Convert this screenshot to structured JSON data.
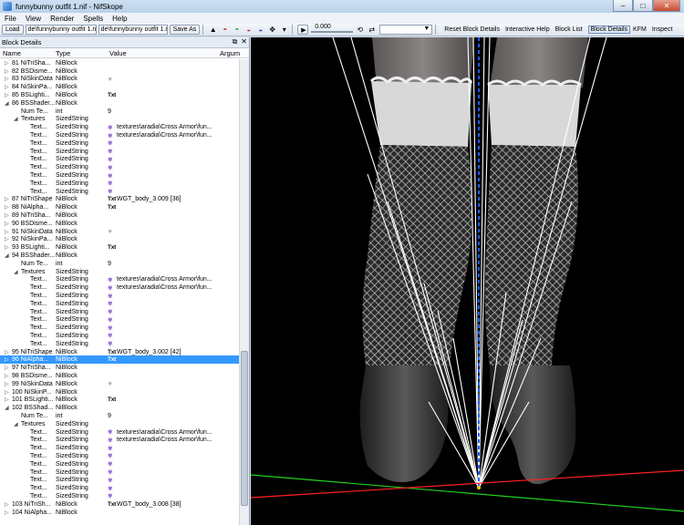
{
  "window": {
    "title": "funnybunny outfit 1.nif - NifSkope",
    "min": "–",
    "max": "□",
    "close": "✕"
  },
  "menu": [
    "File",
    "View",
    "Render",
    "Spells",
    "Help"
  ],
  "toolbar": {
    "load": "Load",
    "load_path": "de\\funnybunny outfit 1.nif",
    "save_path": "de\\funnybunny outfit 1.nif",
    "save_as": "Save As",
    "anim_time": "0.000",
    "links": [
      "Reset Block Details",
      "Interactive Help",
      "Block List",
      "Block Details",
      "KFM",
      "Inspect"
    ],
    "active_link": "Block Details"
  },
  "panel": {
    "title": "Block Details",
    "columns": [
      "Name",
      "Type",
      "Value",
      "Argum"
    ],
    "rows": [
      {
        "indent": 0,
        "exp": "▷",
        "name": "81 NiTriSha...",
        "type": "NiBlock",
        "icon": "",
        "value": ""
      },
      {
        "indent": 0,
        "exp": "▷",
        "name": "82 BSDisme...",
        "type": "NiBlock",
        "icon": "",
        "value": ""
      },
      {
        "indent": 0,
        "exp": "▷",
        "name": "83 NiSkinData",
        "type": "NiBlock",
        "icon": "star",
        "value": ""
      },
      {
        "indent": 0,
        "exp": "▷",
        "name": "84 NiSkinPa...",
        "type": "NiBlock",
        "icon": "",
        "value": ""
      },
      {
        "indent": 0,
        "exp": "▷",
        "name": "85 BSLighti...",
        "type": "NiBlock",
        "icon": "txt",
        "value": ""
      },
      {
        "indent": 0,
        "exp": "◢",
        "name": "86 BSShader...",
        "type": "NiBlock",
        "icon": "",
        "value": ""
      },
      {
        "indent": 1,
        "exp": "",
        "name": "Num Te...",
        "type": "int",
        "icon": "",
        "value": "9"
      },
      {
        "indent": 1,
        "exp": "◢",
        "name": "Textures",
        "type": "SizedString",
        "icon": "",
        "value": ""
      },
      {
        "indent": 2,
        "exp": "",
        "name": "Text...",
        "type": "SizedString",
        "icon": "tex",
        "value": "textures\\aradia\\Cross Armor\\fun..."
      },
      {
        "indent": 2,
        "exp": "",
        "name": "Text...",
        "type": "SizedString",
        "icon": "tex",
        "value": "textures\\aradia\\Cross Armor\\fun..."
      },
      {
        "indent": 2,
        "exp": "",
        "name": "Text...",
        "type": "SizedString",
        "icon": "tex",
        "value": ""
      },
      {
        "indent": 2,
        "exp": "",
        "name": "Text...",
        "type": "SizedString",
        "icon": "tex",
        "value": ""
      },
      {
        "indent": 2,
        "exp": "",
        "name": "Text...",
        "type": "SizedString",
        "icon": "tex",
        "value": ""
      },
      {
        "indent": 2,
        "exp": "",
        "name": "Text...",
        "type": "SizedString",
        "icon": "tex",
        "value": ""
      },
      {
        "indent": 2,
        "exp": "",
        "name": "Text...",
        "type": "SizedString",
        "icon": "tex",
        "value": ""
      },
      {
        "indent": 2,
        "exp": "",
        "name": "Text...",
        "type": "SizedString",
        "icon": "tex",
        "value": ""
      },
      {
        "indent": 2,
        "exp": "",
        "name": "Text...",
        "type": "SizedString",
        "icon": "tex",
        "value": ""
      },
      {
        "indent": 0,
        "exp": "▷",
        "name": "87 NiTriShape",
        "type": "NiBlock",
        "icon": "txt",
        "value": "WGT_body_3.009 [36]"
      },
      {
        "indent": 0,
        "exp": "▷",
        "name": "88 NiAlpha...",
        "type": "NiBlock",
        "icon": "txt",
        "value": ""
      },
      {
        "indent": 0,
        "exp": "▷",
        "name": "89 NiTriSha...",
        "type": "NiBlock",
        "icon": "",
        "value": ""
      },
      {
        "indent": 0,
        "exp": "▷",
        "name": "90 BSDisme...",
        "type": "NiBlock",
        "icon": "",
        "value": ""
      },
      {
        "indent": 0,
        "exp": "▷",
        "name": "91 NiSkinData",
        "type": "NiBlock",
        "icon": "star",
        "value": ""
      },
      {
        "indent": 0,
        "exp": "▷",
        "name": "92 NiSkinPa...",
        "type": "NiBlock",
        "icon": "",
        "value": ""
      },
      {
        "indent": 0,
        "exp": "▷",
        "name": "93 BSLighti...",
        "type": "NiBlock",
        "icon": "txt",
        "value": ""
      },
      {
        "indent": 0,
        "exp": "◢",
        "name": "94 BSShader...",
        "type": "NiBlock",
        "icon": "",
        "value": ""
      },
      {
        "indent": 1,
        "exp": "",
        "name": "Num Te...",
        "type": "int",
        "icon": "",
        "value": "9"
      },
      {
        "indent": 1,
        "exp": "◢",
        "name": "Textures",
        "type": "SizedString",
        "icon": "",
        "value": ""
      },
      {
        "indent": 2,
        "exp": "",
        "name": "Text...",
        "type": "SizedString",
        "icon": "tex",
        "value": "textures\\aradia\\Cross Armor\\fun..."
      },
      {
        "indent": 2,
        "exp": "",
        "name": "Text...",
        "type": "SizedString",
        "icon": "tex",
        "value": "textures\\aradia\\Cross Armor\\fun..."
      },
      {
        "indent": 2,
        "exp": "",
        "name": "Text...",
        "type": "SizedString",
        "icon": "tex",
        "value": ""
      },
      {
        "indent": 2,
        "exp": "",
        "name": "Text...",
        "type": "SizedString",
        "icon": "tex",
        "value": ""
      },
      {
        "indent": 2,
        "exp": "",
        "name": "Text...",
        "type": "SizedString",
        "icon": "tex",
        "value": ""
      },
      {
        "indent": 2,
        "exp": "",
        "name": "Text...",
        "type": "SizedString",
        "icon": "tex",
        "value": ""
      },
      {
        "indent": 2,
        "exp": "",
        "name": "Text...",
        "type": "SizedString",
        "icon": "tex",
        "value": ""
      },
      {
        "indent": 2,
        "exp": "",
        "name": "Text...",
        "type": "SizedString",
        "icon": "tex",
        "value": ""
      },
      {
        "indent": 2,
        "exp": "",
        "name": "Text...",
        "type": "SizedString",
        "icon": "tex",
        "value": ""
      },
      {
        "indent": 0,
        "exp": "▷",
        "name": "95 NiTriShape",
        "type": "NiBlock",
        "icon": "txt",
        "value": "WGT_body_3.002 [42]"
      },
      {
        "indent": 0,
        "exp": "▷",
        "name": "96 NiAlpha...",
        "type": "NiBlock",
        "icon": "txt",
        "value": "",
        "selected": true
      },
      {
        "indent": 0,
        "exp": "▷",
        "name": "97 NiTriSha...",
        "type": "NiBlock",
        "icon": "",
        "value": ""
      },
      {
        "indent": 0,
        "exp": "▷",
        "name": "98 BSDisme...",
        "type": "NiBlock",
        "icon": "",
        "value": ""
      },
      {
        "indent": 0,
        "exp": "▷",
        "name": "99 NiSkinData",
        "type": "NiBlock",
        "icon": "star",
        "value": ""
      },
      {
        "indent": 0,
        "exp": "▷",
        "name": "100 NiSkinP...",
        "type": "NiBlock",
        "icon": "",
        "value": ""
      },
      {
        "indent": 0,
        "exp": "▷",
        "name": "101 BSLighti...",
        "type": "NiBlock",
        "icon": "txt",
        "value": ""
      },
      {
        "indent": 0,
        "exp": "◢",
        "name": "102 BSShad...",
        "type": "NiBlock",
        "icon": "",
        "value": ""
      },
      {
        "indent": 1,
        "exp": "",
        "name": "Num Te...",
        "type": "int",
        "icon": "",
        "value": "9"
      },
      {
        "indent": 1,
        "exp": "◢",
        "name": "Textures",
        "type": "SizedString",
        "icon": "",
        "value": ""
      },
      {
        "indent": 2,
        "exp": "",
        "name": "Text...",
        "type": "SizedString",
        "icon": "tex",
        "value": "textures\\aradia\\Cross Armor\\fun..."
      },
      {
        "indent": 2,
        "exp": "",
        "name": "Text...",
        "type": "SizedString",
        "icon": "tex",
        "value": "textures\\aradia\\Cross Armor\\fun..."
      },
      {
        "indent": 2,
        "exp": "",
        "name": "Text...",
        "type": "SizedString",
        "icon": "tex",
        "value": ""
      },
      {
        "indent": 2,
        "exp": "",
        "name": "Text...",
        "type": "SizedString",
        "icon": "tex",
        "value": ""
      },
      {
        "indent": 2,
        "exp": "",
        "name": "Text...",
        "type": "SizedString",
        "icon": "tex",
        "value": ""
      },
      {
        "indent": 2,
        "exp": "",
        "name": "Text...",
        "type": "SizedString",
        "icon": "tex",
        "value": ""
      },
      {
        "indent": 2,
        "exp": "",
        "name": "Text...",
        "type": "SizedString",
        "icon": "tex",
        "value": ""
      },
      {
        "indent": 2,
        "exp": "",
        "name": "Text...",
        "type": "SizedString",
        "icon": "tex",
        "value": ""
      },
      {
        "indent": 2,
        "exp": "",
        "name": "Text...",
        "type": "SizedString",
        "icon": "tex",
        "value": ""
      },
      {
        "indent": 0,
        "exp": "▷",
        "name": "103 NiTriSh...",
        "type": "NiBlock",
        "icon": "txt",
        "value": "WGT_body_3.008 [38]"
      },
      {
        "indent": 0,
        "exp": "▷",
        "name": "104 NiAlpha...",
        "type": "NiBlock",
        "icon": "",
        "value": ""
      }
    ]
  },
  "icons": {
    "txt": "Txt",
    "tex": "✾",
    "star": "✳"
  },
  "colors": {
    "selection": "#3399ff",
    "viewport_bg": "#000000",
    "axis_x": "#ff2020",
    "axis_y": "#20d020",
    "axis_z": "#2060ff",
    "texture_icon": "#7a44c8"
  }
}
